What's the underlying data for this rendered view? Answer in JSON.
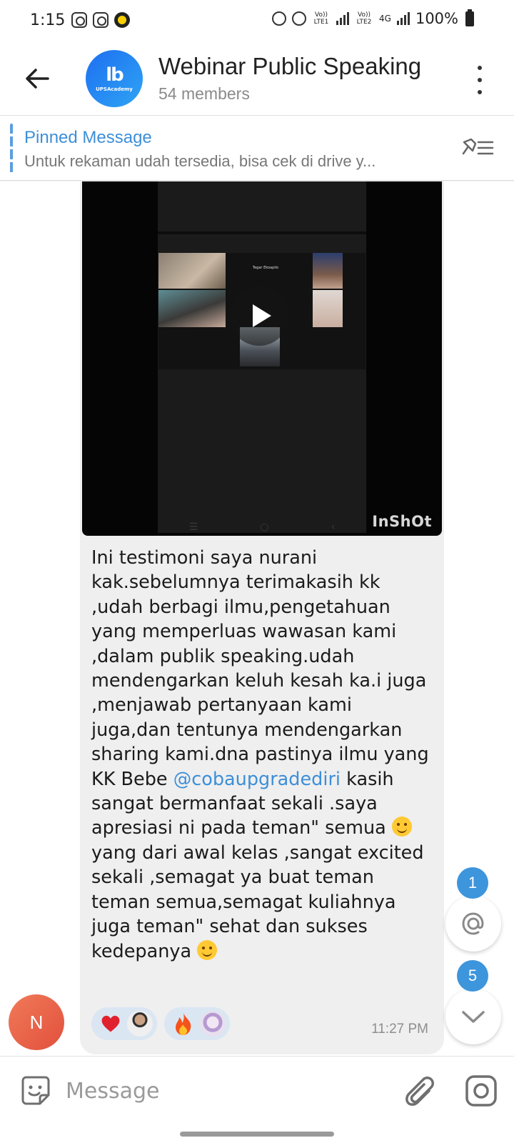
{
  "status_bar": {
    "time": "1:15",
    "net1": "Vo)) LTE1",
    "net2": "Vo)) LTE2",
    "net_type": "4G",
    "battery": "100%"
  },
  "header": {
    "title": "Webinar Public Speaking",
    "subtitle": "54 members",
    "avatar_brand": "UPSAcademy",
    "avatar_logo": "lb"
  },
  "pinned": {
    "title": "Pinned Message",
    "text": "Untuk rekaman udah tersedia, bisa cek di drive y..."
  },
  "message": {
    "video_watermark": "InShOt",
    "video_participant_label": "Tegar Ekoapilo",
    "text_before_mention": "Ini testimoni saya nurani kak.sebelumnya terimakasih kk ,udah berbagi ilmu,pengetahuan yang memperluas wawasan kami ,dalam publik speaking.udah mendengarkan keluh kesah ka.i juga ,menjawab pertanyaan kami juga,dan tentunya mendengarkan sharing kami.dna pastinya ilmu yang KK Bebe ",
    "mention": "@cobaupgradediri",
    "text_after_mention": " kasih sangat bermanfaat sekali .saya apresiasi ni pada teman\" semua ",
    "text_after_emoji": " yang dari awal kelas ,sangat excited sekali ,semagat ya buat teman teman semua,semagat kuliahnya juga teman\" sehat dan sukses kedepanya ",
    "time": "11:27 PM",
    "reactions": [
      {
        "icon": "heart-icon"
      },
      {
        "icon": "fire-icon"
      }
    ]
  },
  "sender_avatar_letter": "N",
  "badges": {
    "mentions": "1",
    "unread": "5"
  },
  "input": {
    "placeholder": "Message"
  },
  "colors": {
    "accent": "#3d8fd8",
    "badge": "#3d95dc",
    "bubble": "#efefef",
    "avatar_orange": "#e2503d"
  }
}
